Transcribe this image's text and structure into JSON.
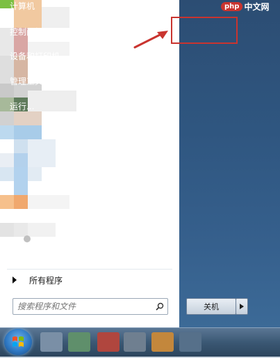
{
  "start_menu": {
    "all_programs_label": "所有程序",
    "search_placeholder": "搜索程序和文件",
    "right_items": [
      {
        "label": "计算机",
        "has_submenu": false
      },
      {
        "label": "控制面板",
        "has_submenu": false,
        "highlighted": true
      },
      {
        "label": "设备和打印机",
        "has_submenu": false
      },
      {
        "label": "管理工具",
        "has_submenu": true
      },
      {
        "label": "运行...",
        "has_submenu": false
      }
    ],
    "shutdown_label": "关机"
  },
  "watermark": {
    "logo": "php",
    "text": "中文网"
  },
  "colors": {
    "highlight_border": "#c9342f",
    "right_pane": "#2f5680",
    "taskbar": "#3b5874"
  }
}
